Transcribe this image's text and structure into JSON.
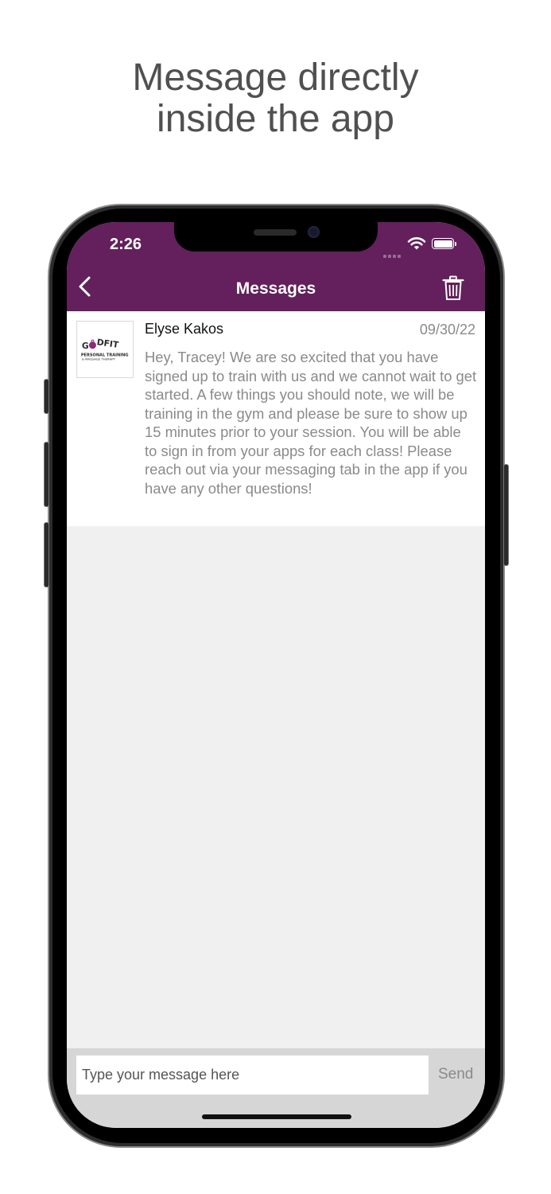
{
  "promo": {
    "headline_line1": "Message directly",
    "headline_line2": "inside the app"
  },
  "status_bar": {
    "time": "2:26"
  },
  "nav": {
    "title": "Messages",
    "back_icon": "chevron-left-icon",
    "delete_icon": "trash-icon"
  },
  "messages": [
    {
      "sender": "Elyse Kakos",
      "date": "09/30/22",
      "logo": {
        "brand": "GODFIT",
        "tagline_1": "PERSONAL TRAINING",
        "tagline_2": "& MASSAGE THERAPY"
      },
      "body": "Hey, Tracey! We are so excited that you have signed up to train with us and we cannot wait to get started. A few things you should note, we will be training in the gym and please be sure to show up 15 minutes prior to your session. You will be able to sign in from your apps for each class! Please reach out via your messaging tab in the app if you have any other questions!"
    }
  ],
  "composer": {
    "placeholder": "Type your message here",
    "send_label": "Send"
  },
  "colors": {
    "header": "#63205c",
    "background": "#f0f0f0",
    "composer_bg": "#d6d6d6"
  }
}
